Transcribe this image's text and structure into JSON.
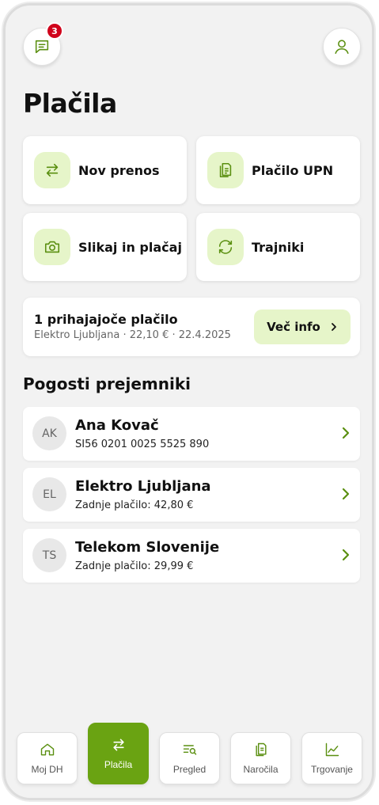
{
  "header": {
    "messages_badge": "3"
  },
  "page": {
    "title": "Plačila"
  },
  "tiles": [
    {
      "label": "Nov prenos",
      "icon": "transfer-arrows-icon"
    },
    {
      "label": "Plačilo UPN",
      "icon": "document-icon"
    },
    {
      "label": "Slikaj in plačaj",
      "icon": "camera-icon"
    },
    {
      "label": "Trajniki",
      "icon": "recurring-arrows-icon"
    }
  ],
  "pending": {
    "title": "1 prihajajoče plačilo",
    "subtitle": "Elektro Ljubljana · 22,10 € · 22.4.2025",
    "button_label": "Več info"
  },
  "recipients": {
    "section_title": "Pogosti prejemniki",
    "items": [
      {
        "initials": "AK",
        "name": "Ana Kovač",
        "detail": "SI56 0201 0025 5525 890"
      },
      {
        "initials": "EL",
        "name": "Elektro Ljubljana",
        "detail": "Zadnje plačilo: 42,80 €"
      },
      {
        "initials": "TS",
        "name": "Telekom Slovenije",
        "detail": "Zadnje plačilo: 29,99 €"
      }
    ]
  },
  "nav": [
    {
      "label": "Moj DH",
      "icon": "home-icon",
      "active": false
    },
    {
      "label": "Plačila",
      "icon": "transfer-arrows-icon",
      "active": true
    },
    {
      "label": "Pregled",
      "icon": "search-list-icon",
      "active": false
    },
    {
      "label": "Naročila",
      "icon": "document-icon",
      "active": false
    },
    {
      "label": "Trgovanje",
      "icon": "chart-icon",
      "active": false
    }
  ],
  "colors": {
    "accent": "#6aa312",
    "accent_light": "#e6f5c9",
    "badge": "#d0021b"
  }
}
